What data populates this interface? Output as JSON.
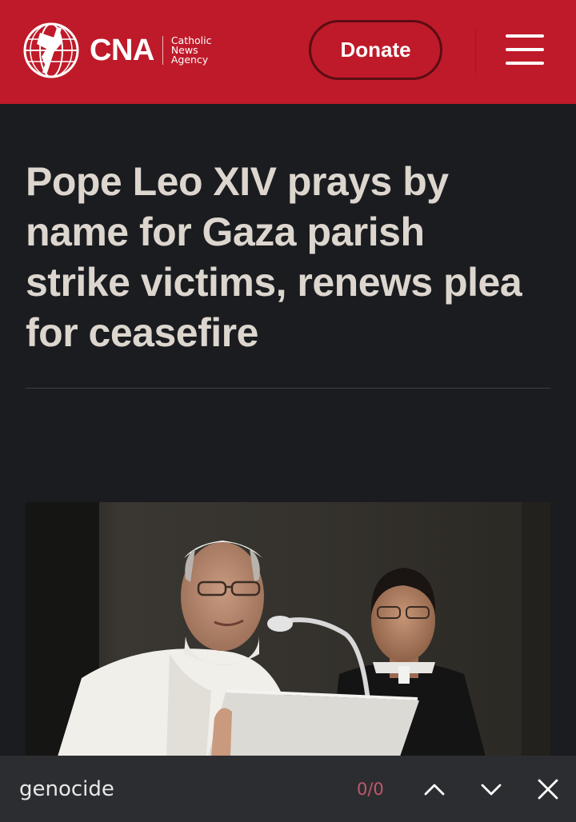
{
  "header": {
    "logo_text": "CNA",
    "logo_sub_lines": [
      "Catholic",
      "News",
      "Agency"
    ],
    "donate_label": "Donate",
    "menu_icon": "hamburger-menu-icon",
    "brand_color": "#bf1a29"
  },
  "article": {
    "headline": "Pope Leo XIV prays by name for Gaza parish strike victims, renews plea for ceasefire"
  },
  "findbar": {
    "query": "genocide",
    "match_count": "0/0",
    "prev_icon": "chevron-up-icon",
    "next_icon": "chevron-down-icon",
    "close_icon": "close-icon"
  }
}
